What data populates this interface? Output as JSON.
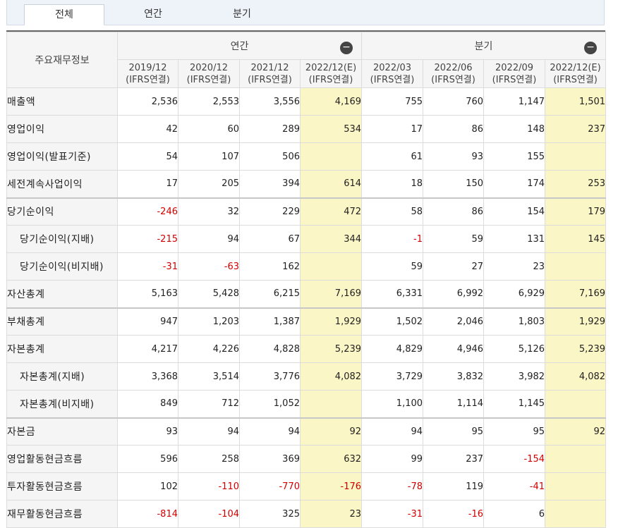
{
  "tabs": [
    {
      "label": "전체",
      "active": true
    },
    {
      "label": "연간",
      "active": false
    },
    {
      "label": "분기",
      "active": false
    }
  ],
  "header": {
    "label_col": "주요재무정보",
    "annual_label": "연간",
    "quarter_label": "분기",
    "collapse_symbol": "−",
    "periods": [
      {
        "date": "2019/12",
        "basis": "(IFRS연결)",
        "estimate": false
      },
      {
        "date": "2020/12",
        "basis": "(IFRS연결)",
        "estimate": false
      },
      {
        "date": "2021/12",
        "basis": "(IFRS연결)",
        "estimate": false
      },
      {
        "date": "2022/12(E)",
        "basis": "(IFRS연결)",
        "estimate": true
      },
      {
        "date": "2022/03",
        "basis": "(IFRS연결)",
        "estimate": false
      },
      {
        "date": "2022/06",
        "basis": "(IFRS연결)",
        "estimate": false
      },
      {
        "date": "2022/09",
        "basis": "(IFRS연결)",
        "estimate": false
      },
      {
        "date": "2022/12(E)",
        "basis": "(IFRS연결)",
        "estimate": true
      }
    ]
  },
  "rows": [
    {
      "label": "매출액",
      "sub": false,
      "sep": false,
      "values": [
        "2,536",
        "2,553",
        "3,556",
        "4,169",
        "755",
        "760",
        "1,147",
        "1,501"
      ]
    },
    {
      "label": "영업이익",
      "sub": false,
      "sep": false,
      "values": [
        "42",
        "60",
        "289",
        "534",
        "17",
        "86",
        "148",
        "237"
      ]
    },
    {
      "label": "영업이익(발표기준)",
      "sub": false,
      "sep": false,
      "values": [
        "54",
        "107",
        "506",
        "",
        "61",
        "93",
        "155",
        ""
      ]
    },
    {
      "label": "세전계속사업이익",
      "sub": false,
      "sep": false,
      "values": [
        "17",
        "205",
        "394",
        "614",
        "18",
        "150",
        "174",
        "253"
      ]
    },
    {
      "label": "당기순이익",
      "sub": false,
      "sep": true,
      "values": [
        "-246",
        "32",
        "229",
        "472",
        "58",
        "86",
        "154",
        "179"
      ]
    },
    {
      "label": "당기순이익(지배)",
      "sub": true,
      "sep": false,
      "values": [
        "-215",
        "94",
        "67",
        "344",
        "-1",
        "59",
        "131",
        "145"
      ]
    },
    {
      "label": "당기순이익(비지배)",
      "sub": true,
      "sep": false,
      "values": [
        "-31",
        "-63",
        "162",
        "",
        "59",
        "27",
        "23",
        ""
      ]
    },
    {
      "label": "자산총계",
      "sub": false,
      "sep": false,
      "values": [
        "5,163",
        "5,428",
        "6,215",
        "7,169",
        "6,331",
        "6,992",
        "6,929",
        "7,169"
      ]
    },
    {
      "label": "부채총계",
      "sub": false,
      "sep": true,
      "values": [
        "947",
        "1,203",
        "1,387",
        "1,929",
        "1,502",
        "2,046",
        "1,803",
        "1,929"
      ]
    },
    {
      "label": "자본총계",
      "sub": false,
      "sep": false,
      "values": [
        "4,217",
        "4,226",
        "4,828",
        "5,239",
        "4,829",
        "4,946",
        "5,126",
        "5,239"
      ]
    },
    {
      "label": "자본총계(지배)",
      "sub": true,
      "sep": false,
      "values": [
        "3,368",
        "3,514",
        "3,776",
        "4,082",
        "3,729",
        "3,832",
        "3,982",
        "4,082"
      ]
    },
    {
      "label": "자본총계(비지배)",
      "sub": true,
      "sep": false,
      "values": [
        "849",
        "712",
        "1,052",
        "",
        "1,100",
        "1,114",
        "1,145",
        ""
      ]
    },
    {
      "label": "자본금",
      "sub": false,
      "sep": true,
      "values": [
        "93",
        "94",
        "94",
        "92",
        "94",
        "95",
        "95",
        "92"
      ]
    },
    {
      "label": "영업활동현금흐름",
      "sub": false,
      "sep": false,
      "values": [
        "596",
        "258",
        "369",
        "632",
        "99",
        "237",
        "-154",
        ""
      ]
    },
    {
      "label": "투자활동현금흐름",
      "sub": false,
      "sep": false,
      "values": [
        "102",
        "-110",
        "-770",
        "-176",
        "-78",
        "119",
        "-41",
        ""
      ]
    },
    {
      "label": "재무활동현금흐름",
      "sub": false,
      "sep": false,
      "values": [
        "-814",
        "-104",
        "325",
        "23",
        "-31",
        "-16",
        "6",
        ""
      ]
    }
  ],
  "colors": {
    "negative": "#d10000",
    "estimate_bg": "#fbf6c6",
    "label_bg": "#f5f5f5"
  }
}
